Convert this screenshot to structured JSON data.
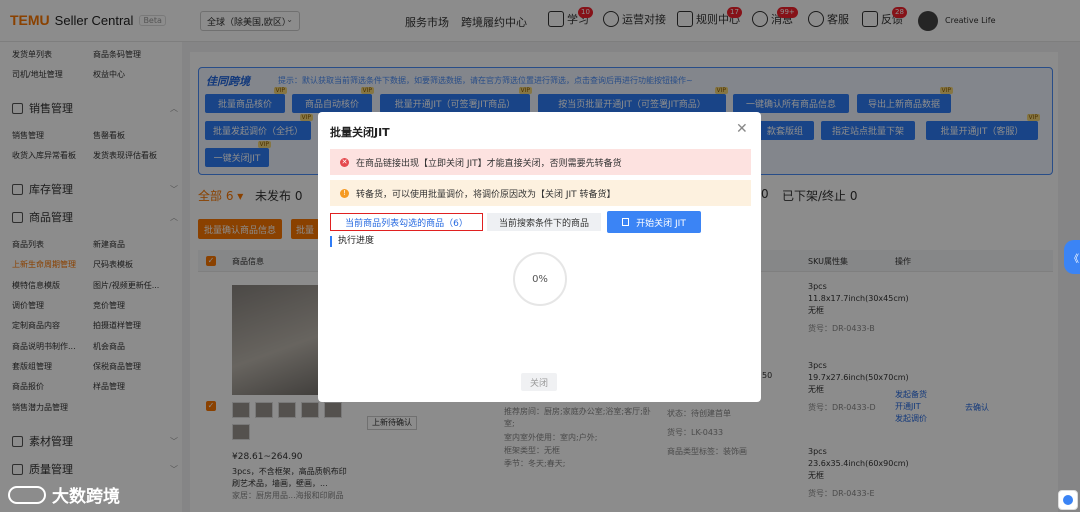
{
  "header": {
    "logo_brand": "TEMU",
    "logo_app": "Seller Central",
    "beta": "Beta",
    "region": "全球（除美国,欧区）",
    "nav_links": [
      "服务市场",
      "跨境履约中心"
    ],
    "nav_icons": [
      {
        "label": "学习",
        "badge": "10"
      },
      {
        "label": "运营对接",
        "badge": ""
      },
      {
        "label": "规则中心",
        "badge": "17"
      },
      {
        "label": "消息",
        "badge": "99+"
      },
      {
        "label": "客服",
        "badge": ""
      },
      {
        "label": "反馈",
        "badge": "28"
      }
    ],
    "shop": "Creative Life"
  },
  "sidebar": {
    "top_links": [
      "发货单列表",
      "商品条码管理",
      "司机/地址管理",
      "权益中心"
    ],
    "sales_title": "销售管理",
    "sales_links": [
      "销售管理",
      "售罄看板",
      "收货入库异常看板",
      "发货表现评估看板"
    ],
    "stock_title": "库存管理",
    "goods_title": "商品管理",
    "goods_links": [
      "商品列表",
      "新建商品",
      "上新生命周期管理",
      "尺码表模板",
      "模特信息模版",
      "图片/视频更新任...",
      "调价管理",
      "竞价管理",
      "定制商品内容",
      "拍摄道样管理",
      "商品说明书制作...",
      "机会商品",
      "套版组管理",
      "保税商品管理",
      "商品报价",
      "样品管理",
      "销售潜力品管理"
    ],
    "material_title": "素材管理",
    "quality_title": "质量管理"
  },
  "panel": {
    "title": "佳同跨境",
    "tip": "提示：默认获取当前筛选条件下数据，如要筛选数据，请在官方筛选位置进行筛选，点击查询后再进行功能按钮操作~",
    "buttons_row1": [
      "批量商品核价",
      "商品自动核价",
      "批量开通JIT（可签署JIT商品）",
      "按当页批量开通JIT（可签署JIT商品）",
      "一键确认所有商品信息",
      "导出上新商品数据"
    ],
    "buttons_row2": [
      "批量发起调价（全托）",
      "款套版组",
      "指定站点批量下架",
      "批量开通JIT（客服）"
    ],
    "buttons_row3": [
      "一键关闭JIT"
    ],
    "vip": "VIP"
  },
  "tabs": {
    "all": "全部",
    "all_count": "6",
    "unsent": "未发布",
    "unsent_count": "0",
    "removed": "已下架/终止",
    "removed_count": "0",
    "mid_count": "0"
  },
  "actions": {
    "confirm_info": "批量确认商品信息",
    "more": "批量"
  },
  "table": {
    "headers": [
      "商品信息",
      "SKU属性集",
      "操作"
    ],
    "price": "¥28.61~264.90",
    "desc": "3pcs，不含框架，高品质帆布印刷艺术品，墙画，壁画，...",
    "desc_sub": "家居：厨房用品...海报和印刷品",
    "status_tag": "上新待确认",
    "attr_lines": [
      "推荐房间：厨房;家庭办公室;浴室;客厅;卧室;",
      "室内室外使用：室内;户外;",
      "框架类型：无框",
      "季节：冬天;春天;"
    ],
    "goods_status": "状态：待创建首单",
    "goods_code": "货号：LK-0433",
    "goods_type": "商品类型标签：装饰画",
    "sku": [
      {
        "a": "3pcs",
        "b": "11.8x17.7inch(30x45cm)无框",
        "c": "货号：DR-0433-B"
      },
      {
        "a": "3pcs",
        "b": "19.7x27.6inch(50x70cm)无框",
        "c": "货号：DR-0433-D"
      },
      {
        "a": "3pcs",
        "b": "23.6x35.4inch(60x90cm)无框",
        "c": "货号：DR-0433-E"
      }
    ],
    "op_links": [
      "发起备货",
      "开通JIT",
      "发起调价"
    ],
    "op_confirm": "去确认",
    "mid_val": "50"
  },
  "modal": {
    "title": "批量关闭JIT",
    "alert_error": "在商品链接出现【立即关闭 JIT】才能直接关闭，否则需要先转备货",
    "alert_warn": "转备货，可以使用批量调价，将调价原因改为【关闭 JIT 转备货】",
    "tab_selected": "当前商品列表勾选的商品（6）",
    "tab_search": "当前搜索条件下的商品",
    "start_button": "开始关闭 JIT",
    "progress_label": "执行进度",
    "progress_value": "0%",
    "close_button": "关闭"
  },
  "watermark": "大数跨境",
  "colors": {
    "brand_orange": "#fb7701",
    "primary_blue": "#2f7cf6",
    "error_red": "#e02020"
  }
}
